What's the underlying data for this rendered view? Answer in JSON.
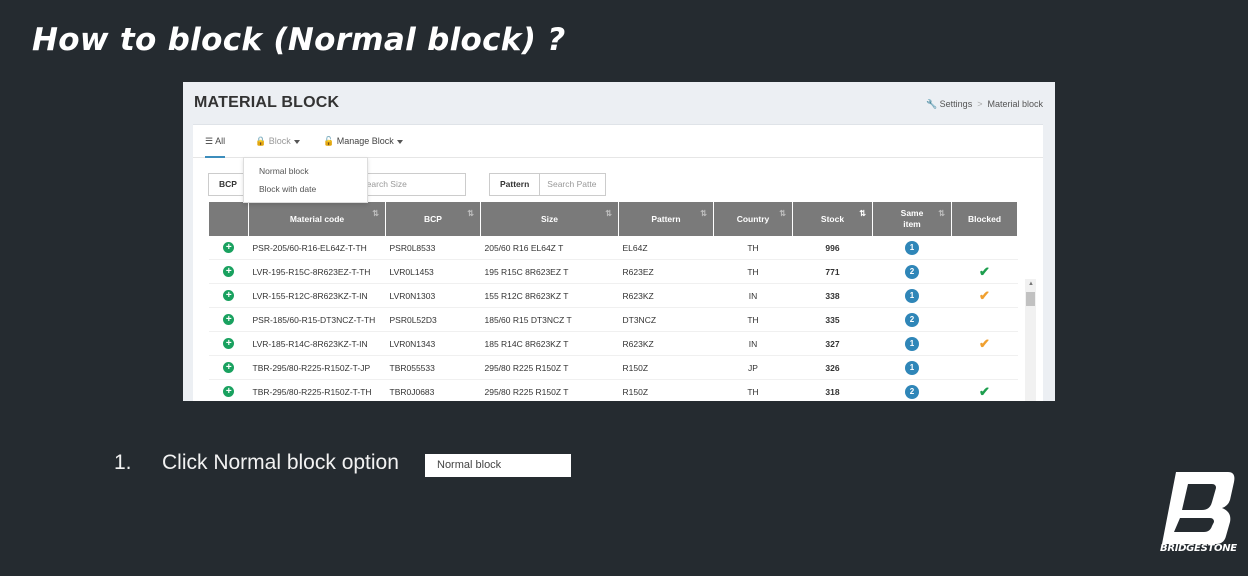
{
  "slide": {
    "title": "How to block (Normal block) ?",
    "step_number": "1.",
    "step_text": "Click Normal block option",
    "sample_box": "Normal block",
    "logo_text": "BRIDGESTONE"
  },
  "app": {
    "page_title": "MATERIAL BLOCK",
    "breadcrumb": [
      "Settings",
      "Material block"
    ],
    "tabs": [
      {
        "label": "All",
        "icon": "list-icon",
        "active": true
      },
      {
        "label": "Block",
        "icon": "lock-icon",
        "disabled": true
      },
      {
        "label": "Manage Block",
        "icon": "unlock-icon"
      }
    ],
    "dropdown": [
      "Normal block",
      "Block with date"
    ],
    "filters": [
      {
        "label": "BCP",
        "placeholder": ""
      },
      {
        "label": "Size",
        "placeholder": "Search Size"
      },
      {
        "label": "Pattern",
        "placeholder": "Search Patte"
      }
    ],
    "columns": [
      "",
      "Material code",
      "BCP",
      "Size",
      "Pattern",
      "Country",
      "Stock",
      "Same item",
      "Blocked"
    ],
    "rows": [
      {
        "material": "PSR-205/60-R16-EL64Z-T-TH",
        "bcp": "PSR0L8533",
        "size": "205/60 R16 EL64Z T",
        "pattern": "EL64Z",
        "country": "TH",
        "stock": "996",
        "same": "1",
        "blocked": ""
      },
      {
        "material": "LVR-195-R15C-8R623EZ-T-TH",
        "bcp": "LVR0L1453",
        "size": "195 R15C 8R623EZ T",
        "pattern": "R623EZ",
        "country": "TH",
        "stock": "771",
        "same": "2",
        "blocked": "green"
      },
      {
        "material": "LVR-155-R12C-8R623KZ-T-IN",
        "bcp": "LVR0N1303",
        "size": "155 R12C 8R623KZ T",
        "pattern": "R623KZ",
        "country": "IN",
        "stock": "338",
        "same": "1",
        "blocked": "orange"
      },
      {
        "material": "PSR-185/60-R15-DT3NCZ-T-TH",
        "bcp": "PSR0L52D3",
        "size": "185/60 R15 DT3NCZ T",
        "pattern": "DT3NCZ",
        "country": "TH",
        "stock": "335",
        "same": "2",
        "blocked": ""
      },
      {
        "material": "LVR-185-R14C-8R623KZ-T-IN",
        "bcp": "LVR0N1343",
        "size": "185 R14C 8R623KZ T",
        "pattern": "R623KZ",
        "country": "IN",
        "stock": "327",
        "same": "1",
        "blocked": "orange"
      },
      {
        "material": "TBR-295/80-R225-R150Z-T-JP",
        "bcp": "TBR055533",
        "size": "295/80 R225 R150Z T",
        "pattern": "R150Z",
        "country": "JP",
        "stock": "326",
        "same": "1",
        "blocked": ""
      },
      {
        "material": "TBR-295/80-R225-R150Z-T-TH",
        "bcp": "TBR0J0683",
        "size": "295/80 R225 R150Z T",
        "pattern": "R150Z",
        "country": "TH",
        "stock": "318",
        "same": "2",
        "blocked": "green"
      }
    ],
    "colors": {
      "header_bg": "#7a7a7a",
      "badge": "#2f86b8",
      "plus": "#19a15f",
      "check_green": "#1d9e4e",
      "check_orange": "#f0a030",
      "slide_bg": "#252b30"
    }
  }
}
